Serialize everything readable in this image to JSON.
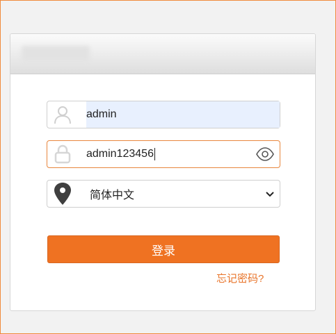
{
  "login": {
    "username_value": "admin",
    "password_value": "admin123456",
    "language_selected": "简体中文",
    "submit_label": "登录",
    "forgot_label": "忘记密码?"
  },
  "icons": {
    "username": "user-icon",
    "password": "lock-icon",
    "language": "map-pin-icon",
    "show_password": "eye-icon",
    "dropdown": "chevron-down-icon"
  },
  "colors": {
    "accent": "#ef7222",
    "focus_border": "#e8863d",
    "autofill_bg": "#e8f0fe"
  }
}
